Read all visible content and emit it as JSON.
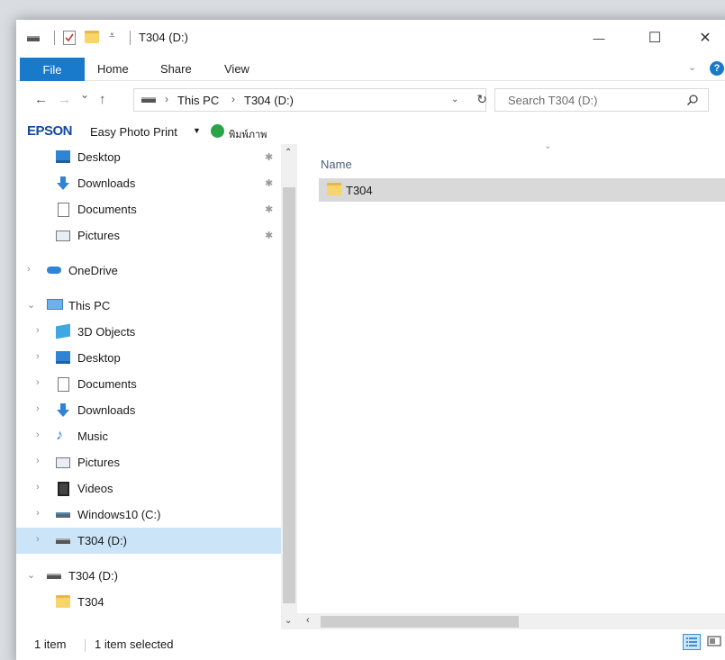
{
  "window": {
    "title": "T304 (D:)",
    "minimize_glyph": "—",
    "maximize_glyph": "☐",
    "close_glyph": "✕"
  },
  "ribbon": {
    "tabs": [
      "File",
      "Home",
      "Share",
      "View"
    ],
    "help_glyph": "?"
  },
  "navigation": {
    "back_glyph": "←",
    "forward_glyph": "→",
    "recent_glyph": "⌄",
    "up_glyph": "↑",
    "breadcrumb": [
      "This PC",
      "T304 (D:)"
    ],
    "breadcrumb_separator": "›",
    "refresh_glyph": "↻",
    "dropdown_glyph": "⌄"
  },
  "search": {
    "placeholder": "Search T304 (D:)"
  },
  "epson_toolbar": {
    "logo": "EPSON",
    "app_label": "Easy Photo Print",
    "caret": "▼",
    "print_label": "พิมพ์ภาพ"
  },
  "nav_pane": {
    "quick_access": [
      {
        "label": "Desktop",
        "icon": "desktop-icon",
        "pinned": true
      },
      {
        "label": "Downloads",
        "icon": "downloads-icon",
        "pinned": true
      },
      {
        "label": "Documents",
        "icon": "documents-icon",
        "pinned": true
      },
      {
        "label": "Pictures",
        "icon": "pictures-icon",
        "pinned": true
      }
    ],
    "onedrive": "OneDrive",
    "this_pc": "This PC",
    "this_pc_items": [
      {
        "label": "3D Objects",
        "icon": "3d-objects-icon"
      },
      {
        "label": "Desktop",
        "icon": "desktop-icon"
      },
      {
        "label": "Documents",
        "icon": "documents-icon"
      },
      {
        "label": "Downloads",
        "icon": "downloads-icon"
      },
      {
        "label": "Music",
        "icon": "music-icon"
      },
      {
        "label": "Pictures",
        "icon": "pictures-icon"
      },
      {
        "label": "Videos",
        "icon": "videos-icon"
      },
      {
        "label": "Windows10 (C:)",
        "icon": "drive-c-icon"
      },
      {
        "label": "T304 (D:)",
        "icon": "drive-d-icon",
        "selected": true
      }
    ],
    "drive": "T304 (D:)",
    "drive_children": [
      "T304"
    ],
    "pin_glyph": "📌"
  },
  "content": {
    "column_header": "Name",
    "rows": [
      {
        "name": "T304",
        "type": "folder",
        "selected": true
      }
    ]
  },
  "status": {
    "item_count": "1 item",
    "selected_count": "1 item selected"
  },
  "colors": {
    "file_tab": "#1979ca",
    "selection": "#cce4f7",
    "epson_blue": "#1448a0",
    "folder_yellow": "#f7d56b"
  }
}
